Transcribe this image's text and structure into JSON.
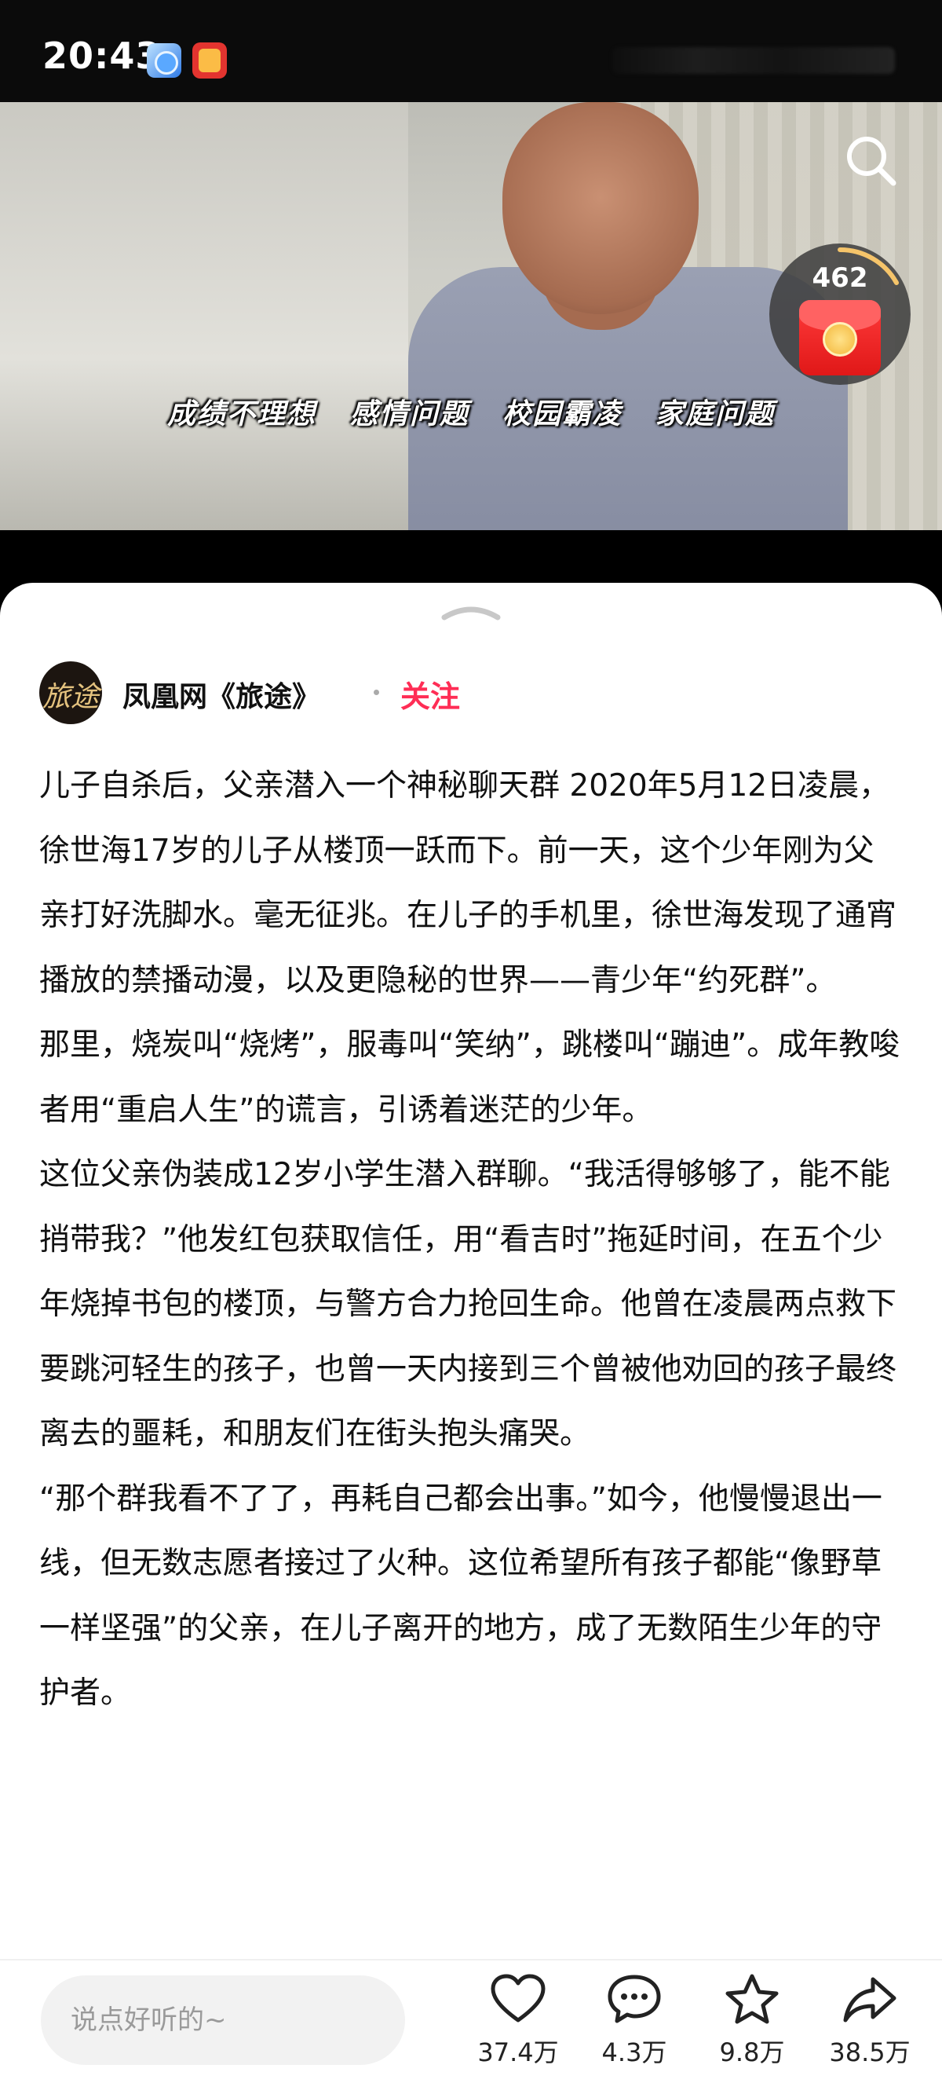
{
  "status_bar": {
    "time": "20:43"
  },
  "video": {
    "tags": [
      "成绩不理想",
      "感情问题",
      "校园霸凌",
      "家庭问题"
    ],
    "reward_count": "462"
  },
  "author": {
    "avatar_text": "旅途",
    "name": "凤凰网《旅途》",
    "follow_label": "关注"
  },
  "article": {
    "paragraphs": [
      "儿子自杀后，父亲潜入一个神秘聊天群 2020年5月12日凌晨，徐世海17岁的儿子从楼顶一跃而下。前一天，这个少年刚为父亲打好洗脚水。毫无征兆。在儿子的手机里，徐世海发现了通宵播放的禁播动漫，以及更隐秘的世界——青少年“约死群”。",
      "那里，烧炭叫“烧烤”，服毒叫“笑纳”，跳楼叫“蹦迪”。成年教唆者用“重启人生”的谎言，引诱着迷茫的少年。",
      "这位父亲伪装成12岁小学生潜入群聊。“我活得够够了，能不能捎带我？”他发红包获取信任，用“看吉时”拖延时间，在五个少年烧掉书包的楼顶，与警方合力抢回生命。他曾在凌晨两点救下要跳河轻生的孩子，也曾一天内接到三个曾被他劝回的孩子最终离去的噩耗，和朋友们在街头抱头痛哭。",
      "“那个群我看不了了，再耗自己都会出事。”如今，他慢慢退出一线，但无数志愿者接过了火种。这位希望所有孩子都能“像野草一样坚强”的父亲，在儿子离开的地方，成了无数陌生少年的守护者。"
    ]
  },
  "bottom_bar": {
    "comment_placeholder": "说点好听的~",
    "like_count": "37.4万",
    "comment_count": "4.3万",
    "favorite_count": "9.8万",
    "share_count": "38.5万"
  }
}
